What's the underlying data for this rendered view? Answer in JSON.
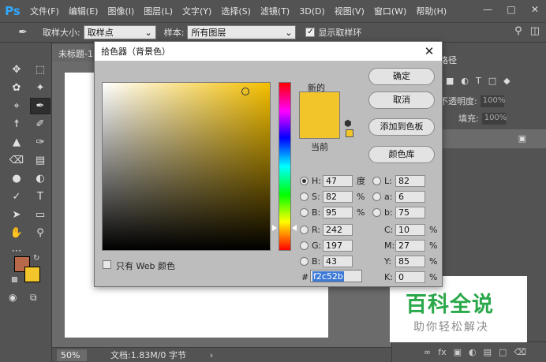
{
  "app": {
    "logo": "Ps",
    "menu": [
      "文件(F)",
      "编辑(E)",
      "图像(I)",
      "图层(L)",
      "文字(Y)",
      "选择(S)",
      "滤镜(T)",
      "3D(D)",
      "视图(V)",
      "窗口(W)",
      "帮助(H)"
    ]
  },
  "options_bar": {
    "tool_icon": "eyedropper-icon",
    "sample_size_label": "取样大小:",
    "sample_size_value": "取样点",
    "sample_label": "样本:",
    "sample_value": "所有图层",
    "show_ring_label": "显示取样环",
    "show_ring_checked": true
  },
  "document": {
    "tab_title": "未标题-1",
    "zoom": "50%",
    "doc_info": "文档:1.83M/0 字节"
  },
  "right_panel": {
    "tab_label": "路径",
    "opacity_label": "不透明度:",
    "opacity_value": "100%",
    "fill_label": "填充:",
    "fill_value": "100%"
  },
  "color_picker": {
    "title": "拾色器（背景色）",
    "new_label": "新的",
    "current_label": "当前",
    "new_color": "#f2c52b",
    "current_color": "#f2c52b",
    "hue_color": "#f5bf00",
    "buttons": {
      "ok": "确定",
      "cancel": "取消",
      "add_to_swatches": "添加到色板",
      "color_libraries": "颜色库"
    },
    "fields": {
      "H": {
        "label": "H:",
        "value": "47",
        "unit": "度"
      },
      "S": {
        "label": "S:",
        "value": "82",
        "unit": "%"
      },
      "Bv": {
        "label": "B:",
        "value": "95",
        "unit": "%"
      },
      "R": {
        "label": "R:",
        "value": "242"
      },
      "G": {
        "label": "G:",
        "value": "197"
      },
      "Bc": {
        "label": "B:",
        "value": "43"
      },
      "L": {
        "label": "L:",
        "value": "82"
      },
      "a": {
        "label": "a:",
        "value": "6"
      },
      "b": {
        "label": "b:",
        "value": "75"
      },
      "C": {
        "label": "C:",
        "value": "10",
        "unit": "%"
      },
      "M": {
        "label": "M:",
        "value": "27",
        "unit": "%"
      },
      "Y": {
        "label": "Y:",
        "value": "85",
        "unit": "%"
      },
      "K": {
        "label": "K:",
        "value": "0",
        "unit": "%"
      }
    },
    "hex_label": "#",
    "hex_value": "f2c52b",
    "web_only_label": "只有 Web 颜色"
  },
  "swatches": {
    "foreground": "#b8694a",
    "background": "#f2c52b"
  },
  "watermark": {
    "main": "百科全说",
    "sub": "助你轻松解决"
  }
}
